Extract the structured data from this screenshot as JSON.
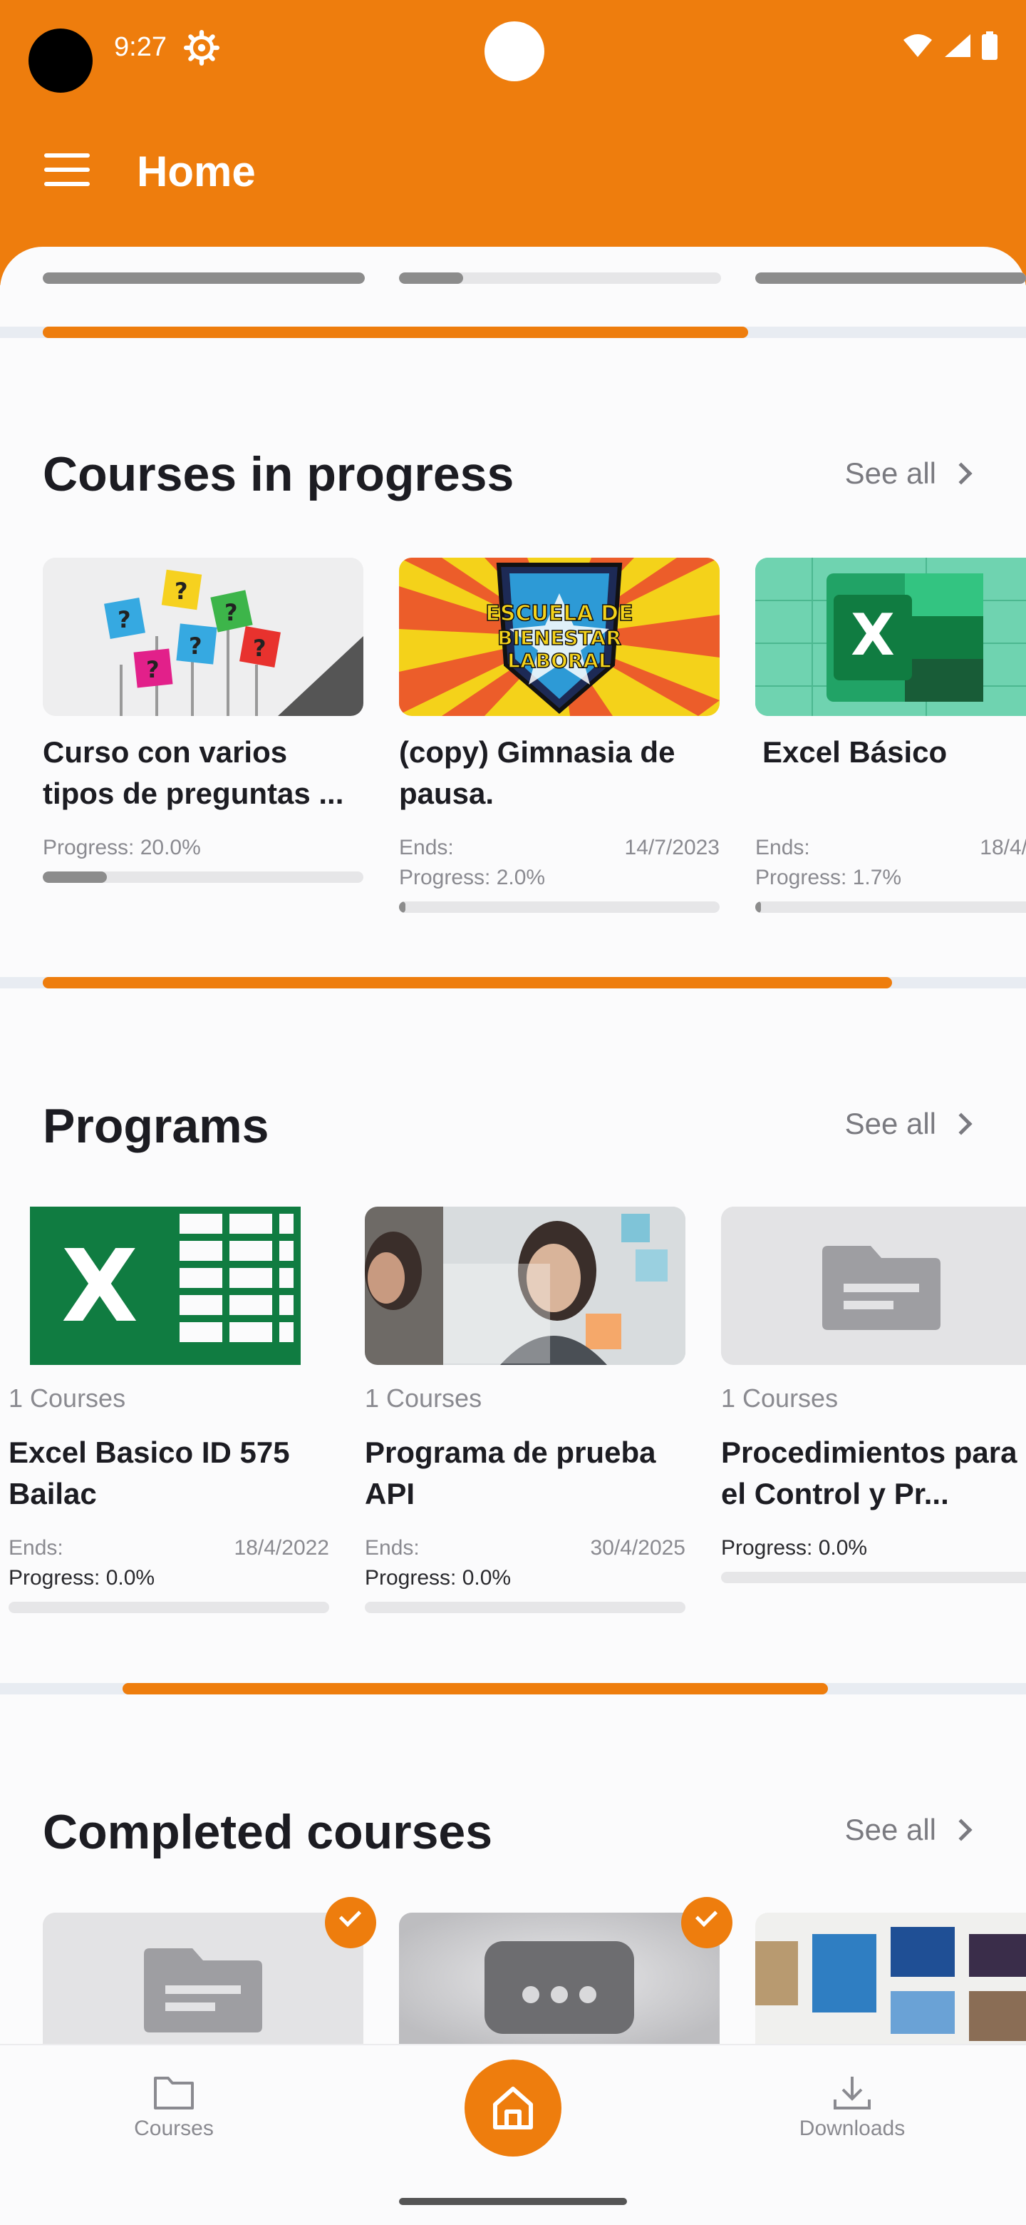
{
  "status_bar": {
    "time": "9:27"
  },
  "app_bar": {
    "title": "Home",
    "menu_icon": "hamburger-menu-icon"
  },
  "colors": {
    "accent": "#ee7d0d",
    "text": "#1c1c22",
    "muted": "#8a8a90"
  },
  "top_peek": {
    "progress": [
      1.0,
      0.2,
      1.0
    ]
  },
  "courses_in_progress": {
    "title": "Courses in progress",
    "see_all": "See all",
    "items": [
      {
        "title": "Curso con varios tipos de preguntas ...",
        "ends_label": "",
        "ends_date": "",
        "progress_label": "Progress: 20.0%",
        "progress": 0.2
      },
      {
        "title": "(copy) Gimnasia de pausa.",
        "ends_label": "Ends:",
        "ends_date": "14/7/2023",
        "progress_label": "Progress: 2.0%",
        "progress": 0.02,
        "thumb_text_1": "ESCUELA DE",
        "thumb_text_2": "BIENESTAR",
        "thumb_text_3": "LABORAL"
      },
      {
        "title": "Excel Básico",
        "ends_label": "Ends:",
        "ends_date": "18/4/",
        "progress_label": "Progress: 1.7%",
        "progress": 0.017,
        "thumb_letter": "X"
      }
    ]
  },
  "programs": {
    "title": "Programs",
    "see_all": "See all",
    "items": [
      {
        "count": "1 Courses",
        "title": "Excel Basico ID 575 Bailac",
        "ends_label": "Ends:",
        "ends_date": "18/4/2022",
        "progress_label": "Progress: 0.0%",
        "progress": 0.0,
        "thumb_letter": "X"
      },
      {
        "count": "1 Courses",
        "title": "Programa de prueba API",
        "ends_label": "Ends:",
        "ends_date": "30/4/2025",
        "progress_label": "Progress: 0.0%",
        "progress": 0.0
      },
      {
        "count": "1 Courses",
        "title": "Procedimientos para el Control y Pr...",
        "ends_label": "",
        "ends_date": "",
        "progress_label": "Progress: 0.0%",
        "progress": 0.0
      }
    ]
  },
  "completed_courses": {
    "title": "Completed courses",
    "see_all": "See all"
  },
  "bottom_nav": {
    "courses": "Courses",
    "downloads": "Downloads"
  }
}
